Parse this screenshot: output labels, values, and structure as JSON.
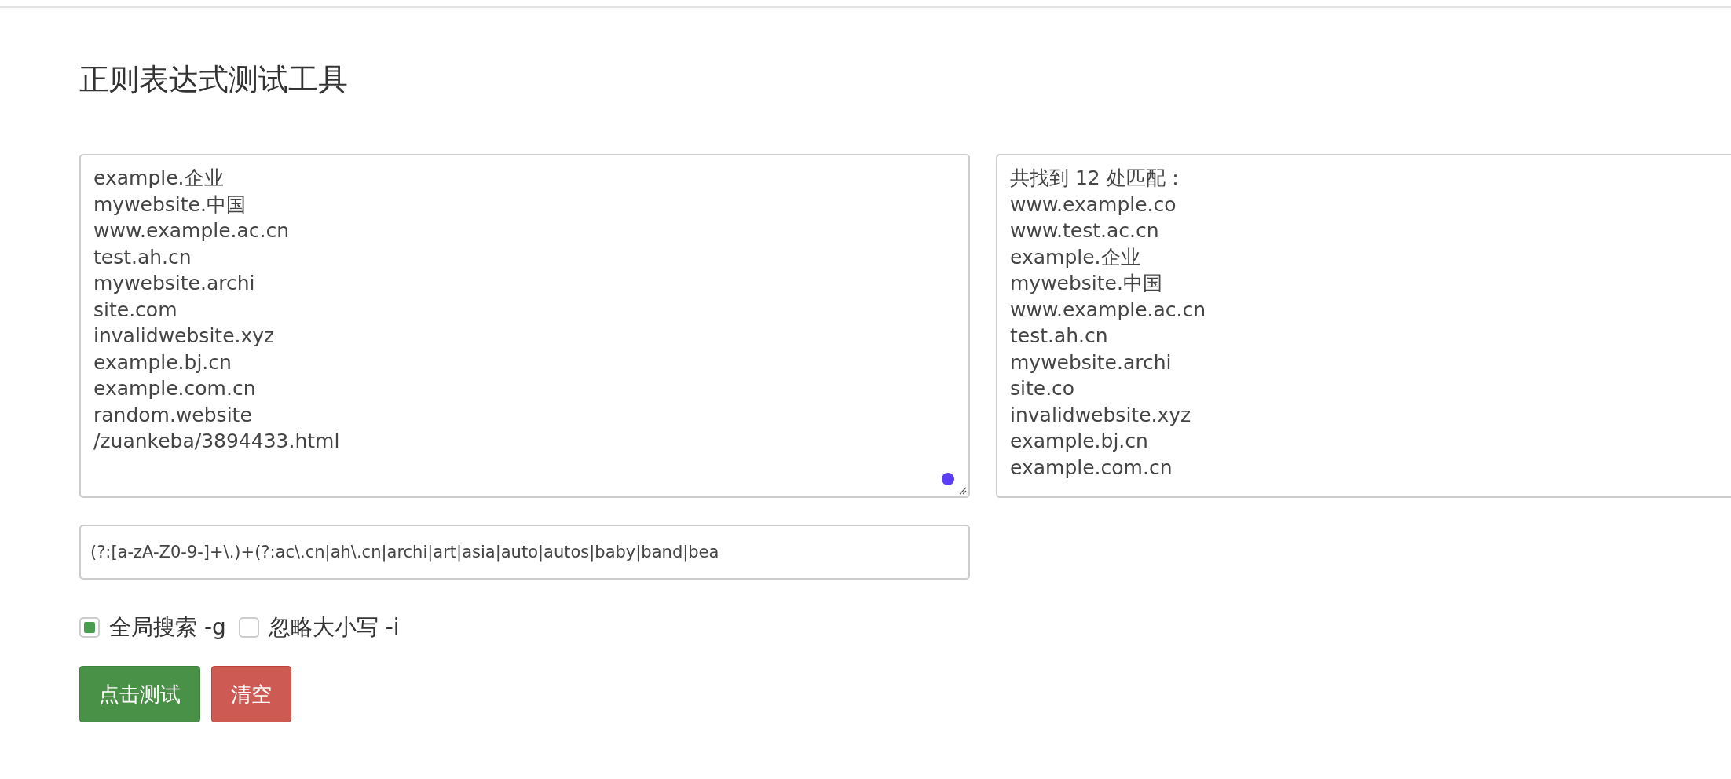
{
  "title": "正则表达式测试工具",
  "source_text": {
    "lines": [
      "example.企业",
      "mywebsite.中国",
      "www.example.ac.cn",
      "test.ah.cn",
      "mywebsite.archi",
      "site.com",
      "invalidwebsite.xyz",
      "example.bj.cn",
      "example.com.cn",
      "random.website",
      "/zuankeba/3894433.html"
    ]
  },
  "result_text": {
    "lines": [
      "共找到 12 处匹配：",
      "www.example.co",
      "www.test.ac.cn",
      "example.企业",
      "mywebsite.中国",
      "www.example.ac.cn",
      "test.ah.cn",
      "mywebsite.archi",
      "site.co",
      "invalidwebsite.xyz",
      "example.bj.cn",
      "example.com.cn"
    ]
  },
  "regex_field": {
    "value": "(?:[a-zA-Z0-9-]+\\.)+(?:ac\\.cn|ah\\.cn|archi|art|asia|auto|autos|baby|band|bea"
  },
  "options": [
    {
      "label": "全局搜索 -g",
      "checked": true
    },
    {
      "label": "忽略大小写 -i",
      "checked": false
    }
  ],
  "buttons": [
    {
      "label": "点击测试",
      "kind": "primary"
    },
    {
      "label": "清空",
      "kind": "danger"
    }
  ]
}
